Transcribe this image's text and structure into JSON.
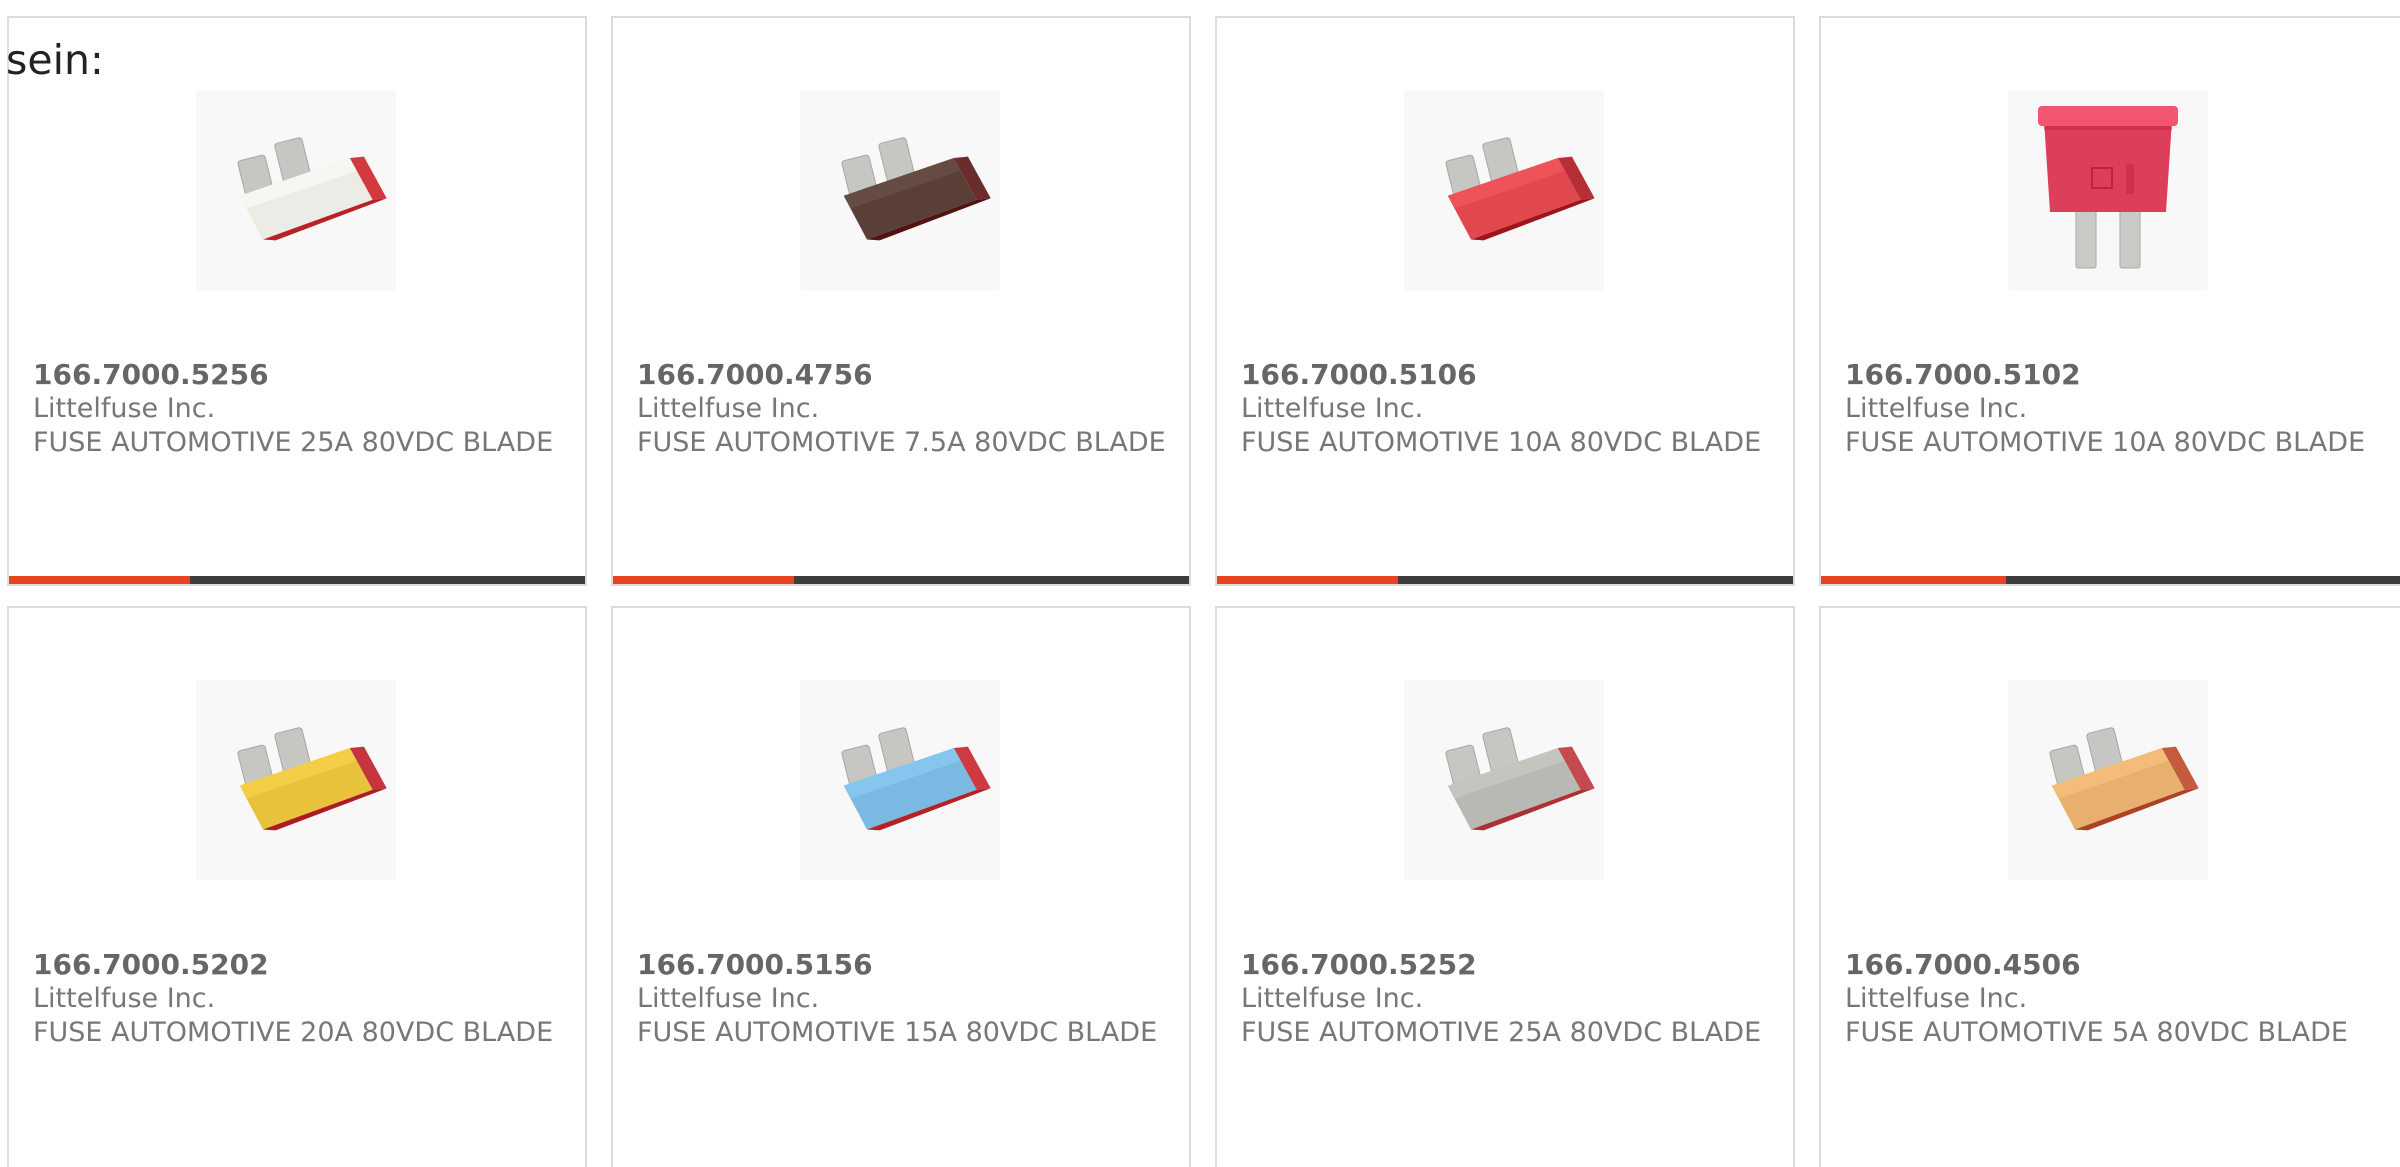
{
  "intro_text": "sein:",
  "colors": {
    "accent": "#e8431e",
    "bar_track": "#3d3d3d",
    "card_border": "#dcdcdc"
  },
  "bar_fill_fraction": 0.315,
  "products": [
    {
      "part_number": "166.7000.5256",
      "manufacturer": "Littelfuse Inc.",
      "description": "FUSE AUTOMOTIVE 25A 80VDC BLADE",
      "image": "fuse-blade-image",
      "body_color": "#ecece6",
      "edge_color": "#d23a3f",
      "orientation": "angled",
      "show_bar": true
    },
    {
      "part_number": "166.7000.4756",
      "manufacturer": "Littelfuse Inc.",
      "description": "FUSE AUTOMOTIVE 7.5A 80VDC BLADE",
      "image": "fuse-blade-image",
      "body_color": "#5a3f37",
      "edge_color": "#6b2c2c",
      "orientation": "angled",
      "show_bar": true
    },
    {
      "part_number": "166.7000.5106",
      "manufacturer": "Littelfuse Inc.",
      "description": "FUSE AUTOMOTIVE 10A 80VDC BLADE",
      "image": "fuse-blade-image",
      "body_color": "#e2474e",
      "edge_color": "#b72f36",
      "orientation": "angled",
      "show_bar": true
    },
    {
      "part_number": "166.7000.5102",
      "manufacturer": "Littelfuse Inc.",
      "description": "FUSE AUTOMOTIVE 10A 80VDC BLADE",
      "image": "fuse-blade-image",
      "body_color": "#dd3f5a",
      "edge_color": "#b52c44",
      "orientation": "upright",
      "show_bar": true
    },
    {
      "part_number": "166.7000.5202",
      "manufacturer": "Littelfuse Inc.",
      "description": "FUSE AUTOMOTIVE 20A 80VDC BLADE",
      "image": "fuse-blade-image",
      "body_color": "#e8c23a",
      "edge_color": "#c6343d",
      "orientation": "angled",
      "show_bar": false
    },
    {
      "part_number": "166.7000.5156",
      "manufacturer": "Littelfuse Inc.",
      "description": "FUSE AUTOMOTIVE 15A 80VDC BLADE",
      "image": "fuse-blade-image",
      "body_color": "#79b9e2",
      "edge_color": "#cf3a42",
      "orientation": "angled",
      "show_bar": false
    },
    {
      "part_number": "166.7000.5252",
      "manufacturer": "Littelfuse Inc.",
      "description": "FUSE AUTOMOTIVE 25A 80VDC BLADE",
      "image": "fuse-blade-image",
      "body_color": "#b9b9b3",
      "edge_color": "#c44a4f",
      "orientation": "angled",
      "show_bar": false
    },
    {
      "part_number": "166.7000.4506",
      "manufacturer": "Littelfuse Inc.",
      "description": "FUSE AUTOMOTIVE 5A 80VDC BLADE",
      "image": "fuse-blade-image",
      "body_color": "#e8b06e",
      "edge_color": "#c65a3c",
      "orientation": "angled",
      "show_bar": false
    }
  ]
}
